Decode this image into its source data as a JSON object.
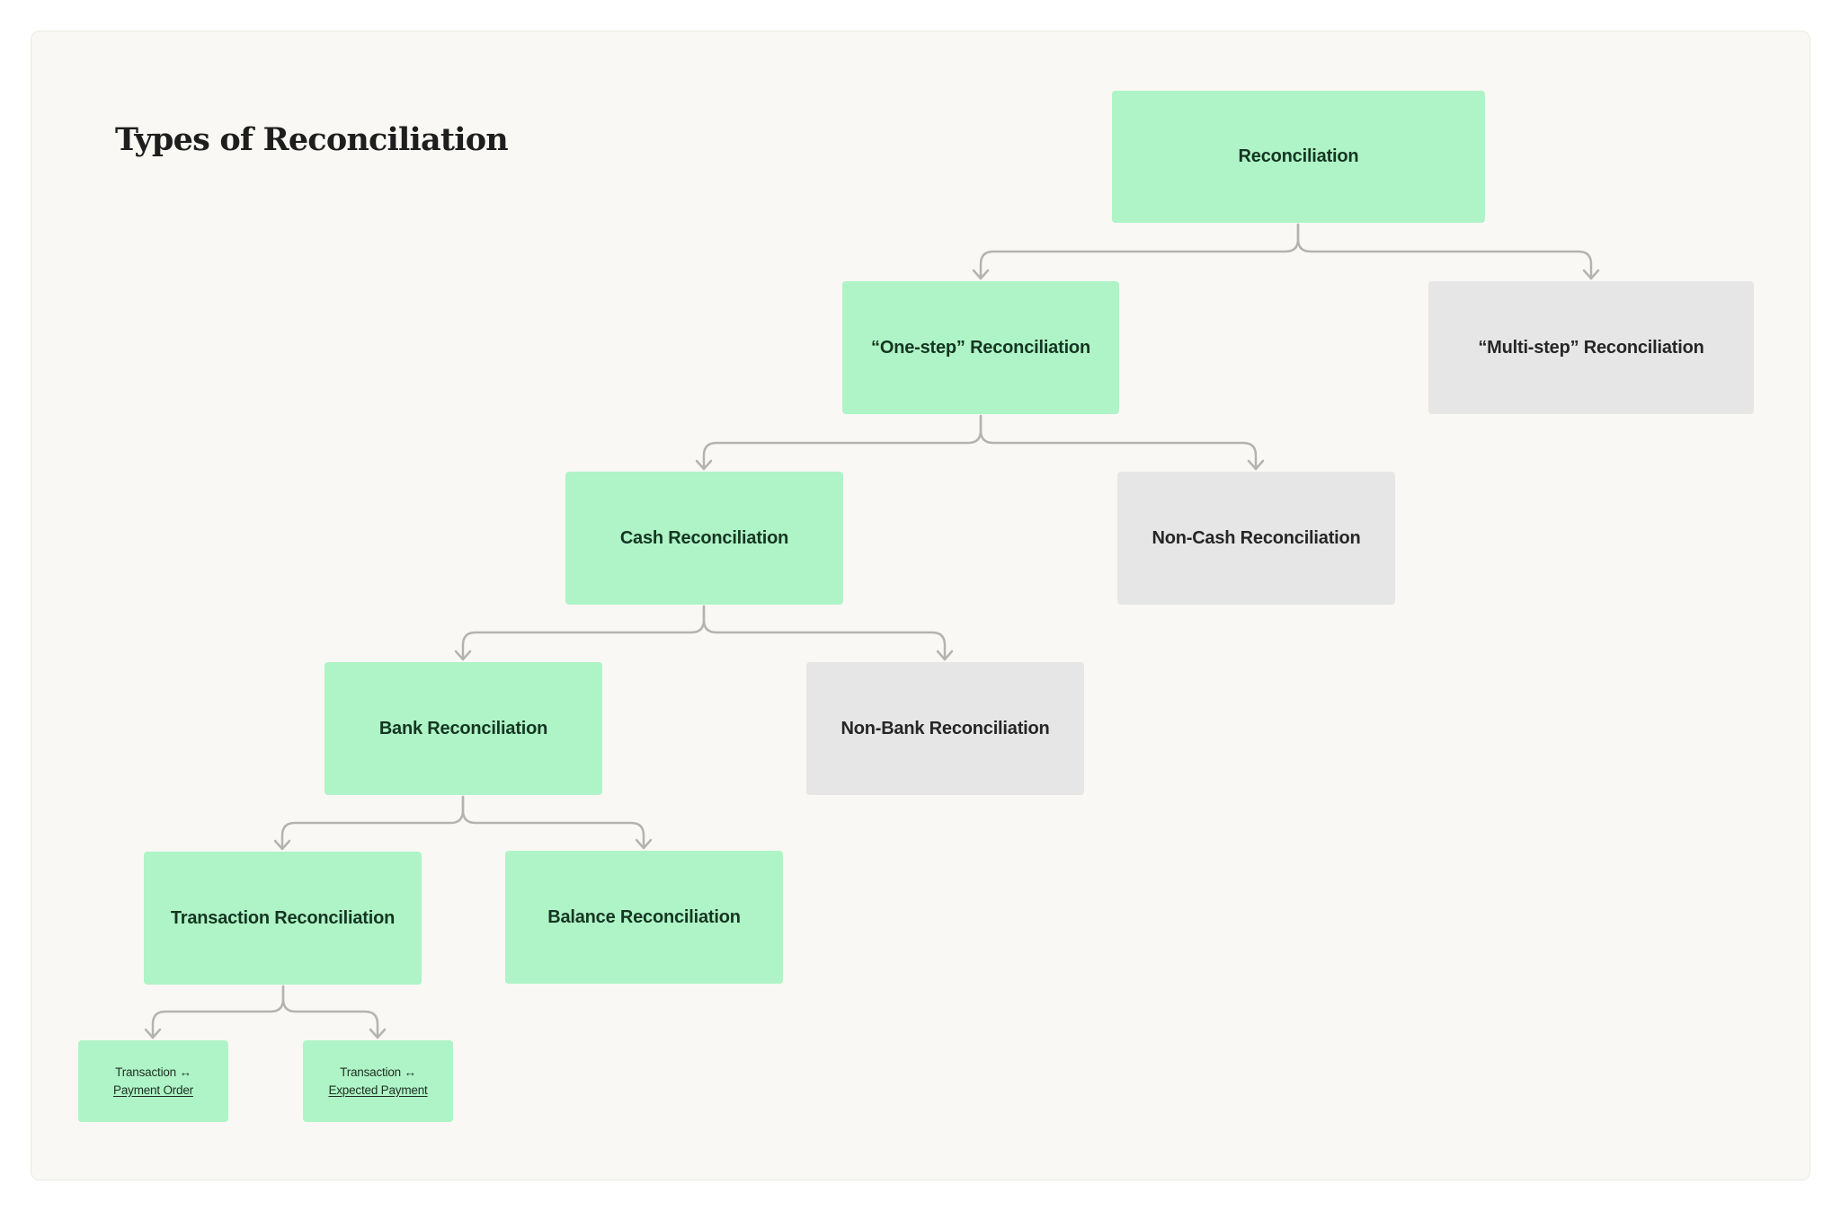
{
  "title": "Types of Reconciliation",
  "colors": {
    "active_node": "#aff4c6",
    "inactive_node": "#e6e6e6",
    "connector": "#b3b3b0",
    "background": "#f9f8f5"
  },
  "nodes": {
    "root": {
      "label": "Reconciliation",
      "state": "active"
    },
    "one_step": {
      "label": "“One-step” Reconciliation",
      "state": "active"
    },
    "multi_step": {
      "label": "“Multi-step” Reconciliation",
      "state": "inactive"
    },
    "cash": {
      "label": "Cash Reconciliation",
      "state": "active"
    },
    "non_cash": {
      "label": "Non-Cash Reconciliation",
      "state": "inactive"
    },
    "bank": {
      "label": "Bank Reconciliation",
      "state": "active"
    },
    "non_bank": {
      "label": "Non-Bank Reconciliation",
      "state": "inactive"
    },
    "transaction": {
      "label": "Transaction Reconciliation",
      "state": "active"
    },
    "balance": {
      "label": "Balance Reconciliation",
      "state": "active"
    },
    "txn_payment_order": {
      "line1": "Transaction ↔",
      "line2": "Payment Order",
      "state": "active"
    },
    "txn_expected_payment": {
      "line1": "Transaction ↔",
      "line2": "Expected Payment",
      "state": "active"
    }
  },
  "edges": [
    {
      "from": "root",
      "to": "one_step"
    },
    {
      "from": "root",
      "to": "multi_step"
    },
    {
      "from": "one_step",
      "to": "cash"
    },
    {
      "from": "one_step",
      "to": "non_cash"
    },
    {
      "from": "cash",
      "to": "bank"
    },
    {
      "from": "cash",
      "to": "non_cash_placeholder_none"
    },
    {
      "from": "cash",
      "to": "non_bank"
    },
    {
      "from": "bank",
      "to": "transaction"
    },
    {
      "from": "bank",
      "to": "balance"
    },
    {
      "from": "transaction",
      "to": "txn_payment_order"
    },
    {
      "from": "transaction",
      "to": "txn_expected_payment"
    }
  ]
}
